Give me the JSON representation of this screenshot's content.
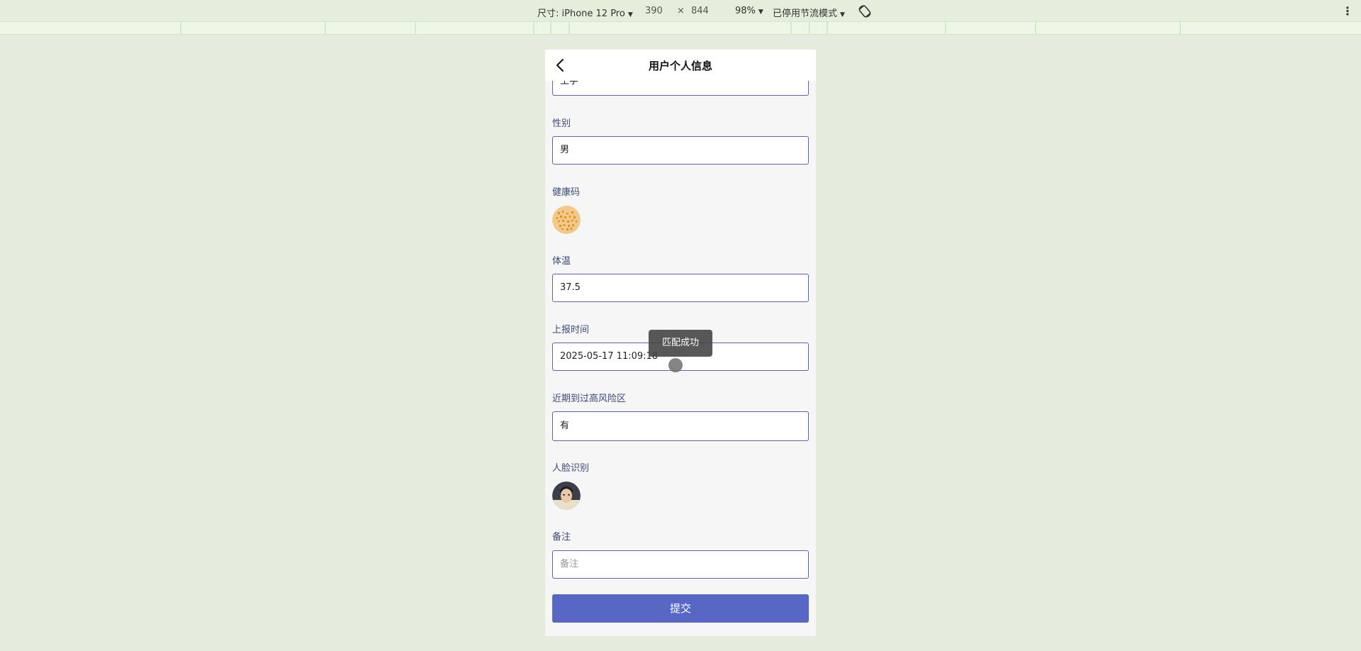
{
  "devtools": {
    "size_label": "尺寸: iPhone 12 Pro",
    "width": "390",
    "times": "×",
    "height": "844",
    "zoom": "98%",
    "throttle": "已停用节流模式",
    "more": "⋮"
  },
  "nav": {
    "title": "用户个人信息"
  },
  "fields": {
    "name_value": "王宇",
    "gender_label": "性别",
    "gender_value": "男",
    "health_code_label": "健康码",
    "temperature_label": "体温",
    "temperature_value": "37.5",
    "report_time_label": "上报时间",
    "report_time_value": "2025-05-17 11:09:18",
    "risk_area_label": "近期到过高风险区",
    "risk_area_value": "有",
    "face_label": "人脸识别",
    "remark_label": "备注",
    "remark_placeholder": "备注"
  },
  "submit_label": "提交",
  "toast": "匹配成功",
  "colors": {
    "accent": "#5767c3",
    "border": "#5a66a8",
    "label": "#3b4a7a",
    "page_bg": "#e6ecdd"
  }
}
